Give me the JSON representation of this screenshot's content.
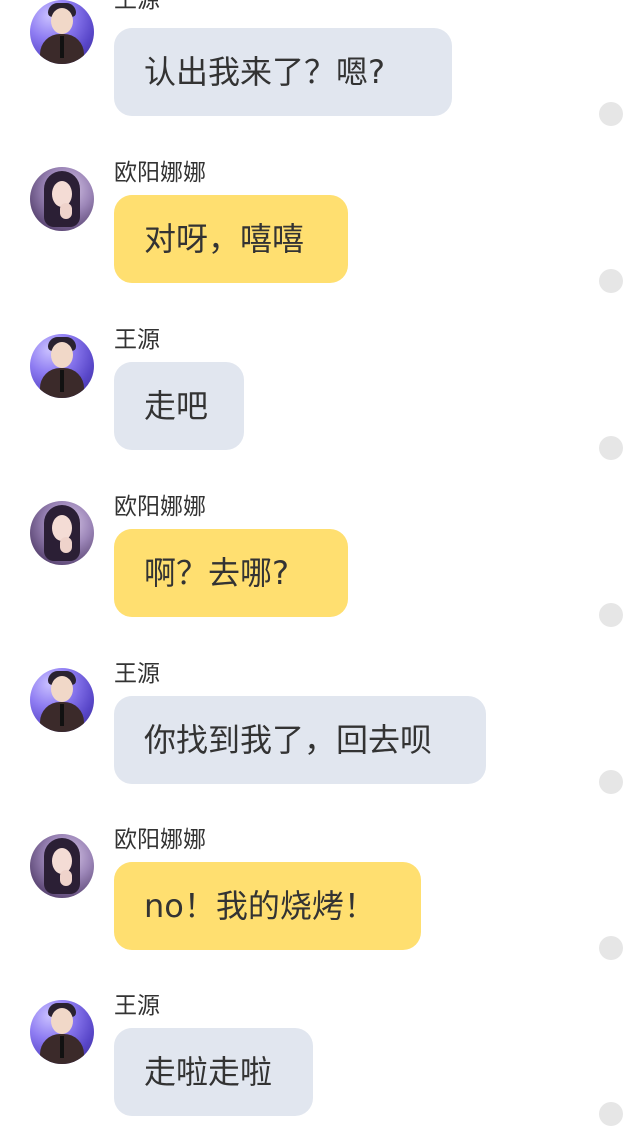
{
  "messages": [
    {
      "sender": "王源",
      "text": "认出我来了？嗯?",
      "bubble_color": "#e1e6ef",
      "avatar": "male-avatar"
    },
    {
      "sender": "欧阳娜娜",
      "text": "对呀，嘻嘻",
      "bubble_color": "#ffdf70",
      "avatar": "female-avatar"
    },
    {
      "sender": "王源",
      "text": "走吧",
      "bubble_color": "#e1e6ef",
      "avatar": "male-avatar"
    },
    {
      "sender": "欧阳娜娜",
      "text": "啊？去哪?",
      "bubble_color": "#ffdf70",
      "avatar": "female-avatar"
    },
    {
      "sender": "王源",
      "text": "你找到我了，回去呗",
      "bubble_color": "#e1e6ef",
      "avatar": "male-avatar"
    },
    {
      "sender": "欧阳娜娜",
      "text": "no！我的烧烤！",
      "bubble_color": "#ffdf70",
      "avatar": "female-avatar"
    },
    {
      "sender": "王源",
      "text": "走啦走啦",
      "bubble_color": "#e1e6ef",
      "avatar": "male-avatar"
    }
  ]
}
